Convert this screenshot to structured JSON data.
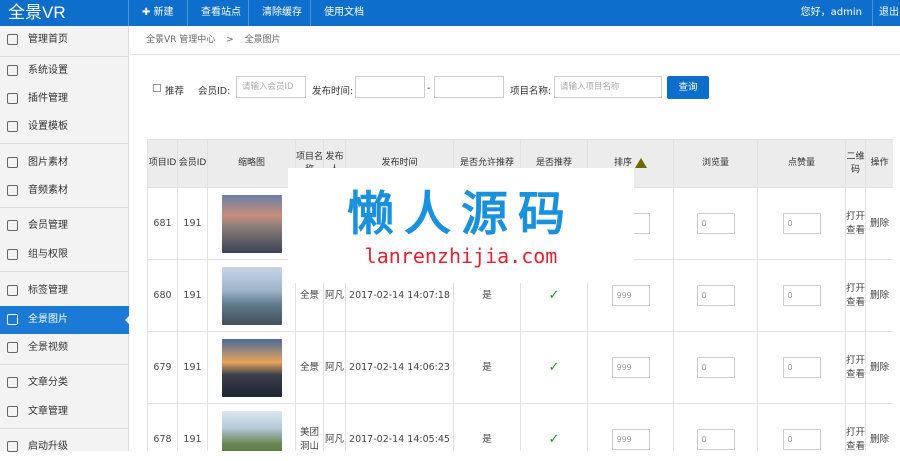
{
  "brand": "全景VR",
  "topnav": [
    {
      "label": "✚ 新建"
    },
    {
      "label": "查看站点"
    },
    {
      "label": "清除缓存"
    },
    {
      "label": "使用文档"
    }
  ],
  "greeting": "您好，admin",
  "logout": "退出",
  "sidebar": [
    {
      "label": "管理首页",
      "icon": "home-icon"
    },
    {
      "label": "系统设置",
      "icon": "gear-icon"
    },
    {
      "label": "插件管理",
      "icon": "send-icon"
    },
    {
      "label": "设置模板",
      "icon": "template-icon"
    },
    {
      "label": "图片素材",
      "icon": "image-icon"
    },
    {
      "label": "音频素材",
      "icon": "link-icon"
    },
    {
      "label": "会员管理",
      "icon": "users-icon"
    },
    {
      "label": "组与权限",
      "icon": "share-icon"
    },
    {
      "label": "标签管理",
      "icon": "tag-icon"
    },
    {
      "label": "全景图片",
      "icon": "panorama-icon"
    },
    {
      "label": "全景视频",
      "icon": "grid-icon"
    },
    {
      "label": "文章分类",
      "icon": "book-icon"
    },
    {
      "label": "文章管理",
      "icon": "file-icon"
    },
    {
      "label": "启动升级",
      "icon": "upgrade-icon"
    }
  ],
  "breadcrumb": {
    "root": "全景VR 管理中心",
    "sep": ">",
    "current": "全景图片"
  },
  "filters": {
    "recommend": "推荐",
    "member_label": "会员ID:",
    "member_placeholder": "请输入会员ID",
    "date_label": "发布时间:",
    "dash": "-",
    "name_label": "项目名称:",
    "name_placeholder": "请输入项目名称",
    "query": "查询"
  },
  "columns": [
    "项目ID",
    "会员ID",
    "缩略图",
    "项目名称",
    "发布人",
    "发布时间",
    "是否允许推荐",
    "是否推荐",
    "排序",
    "浏览量",
    "点赞量",
    "二维码",
    "操作"
  ],
  "rows": [
    {
      "id": "681",
      "member": "191",
      "name": "",
      "author": "",
      "time": "",
      "allow": "",
      "rec": "",
      "sort": "999",
      "views": "0",
      "likes": "0",
      "qr": "打开查看",
      "op": "删除"
    },
    {
      "id": "680",
      "member": "191",
      "name": "全景",
      "author": "阿凡",
      "time": "2017-02-14 14:07:18",
      "allow": "是",
      "rec": "✓",
      "sort": "999",
      "views": "0",
      "likes": "0",
      "qr": "打开查看",
      "op": "删除"
    },
    {
      "id": "679",
      "member": "191",
      "name": "全景",
      "author": "阿凡",
      "time": "2017-02-14 14:06:23",
      "allow": "是",
      "rec": "✓",
      "sort": "999",
      "views": "0",
      "likes": "0",
      "qr": "打开查看",
      "op": "删除"
    },
    {
      "id": "678",
      "member": "191",
      "name": "美团洞山",
      "author": "阿凡",
      "time": "2017-02-14 14:05:45",
      "allow": "是",
      "rec": "✓",
      "sort": "999",
      "views": "0",
      "likes": "0",
      "qr": "打开查看",
      "op": "删除"
    }
  ],
  "watermark": {
    "title": "懒人源码",
    "url": "lanrenzhijia.com"
  }
}
